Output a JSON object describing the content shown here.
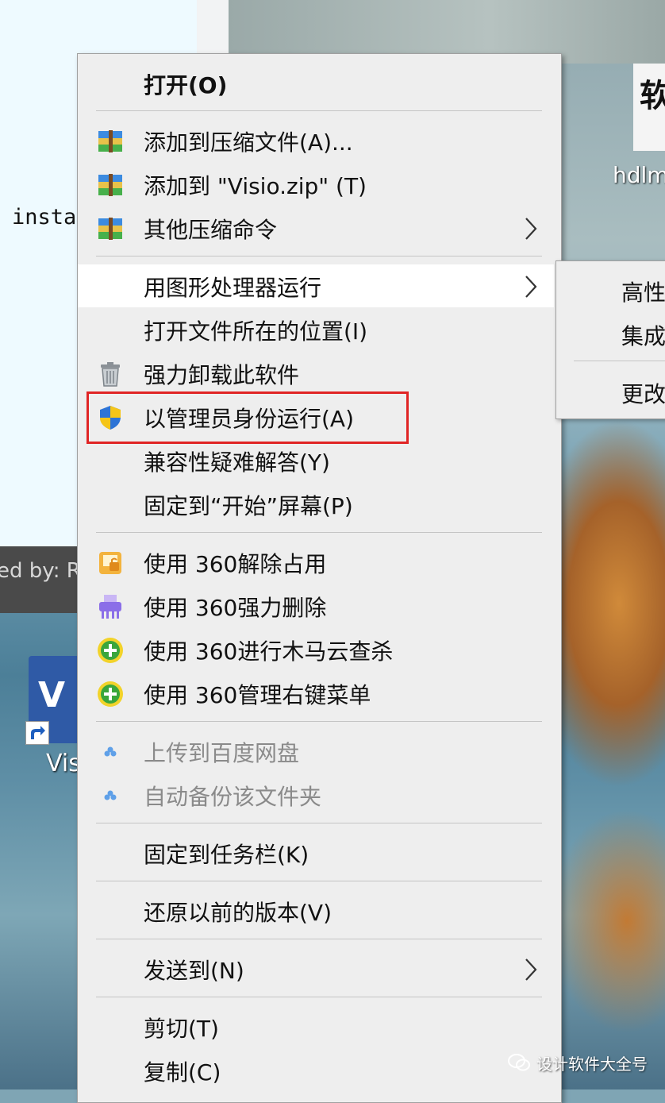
{
  "desktop": {
    "console_text": "insta",
    "status_text": "ed by: R",
    "visio_label": "Vis",
    "visio_letter": "V",
    "app_label": "hdlm",
    "app_glyph": "软"
  },
  "context_menu": {
    "open": "打开(O)",
    "add_to_archive": "添加到压缩文件(A)...",
    "add_to_zip": "添加到 \"Visio.zip\" (T)",
    "other_compress": "其他压缩命令",
    "run_with_gpu": "用图形处理器运行",
    "open_file_location": "打开文件所在的位置(I)",
    "force_uninstall": "强力卸载此软件",
    "run_as_admin": "以管理员身份运行(A)",
    "troubleshoot_compat": "兼容性疑难解答(Y)",
    "pin_to_start": "固定到“开始”屏幕(P)",
    "unlock_360": "使用 360解除占用",
    "force_delete_360": "使用 360强力删除",
    "trojan_scan_360": "使用 360进行木马云查杀",
    "manage_menu_360": "使用 360管理右键菜单",
    "upload_baidu": "上传到百度网盘",
    "auto_backup": "自动备份该文件夹",
    "pin_to_taskbar": "固定到任务栏(K)",
    "restore_versions": "还原以前的版本(V)",
    "send_to": "发送到(N)",
    "cut": "剪切(T)",
    "copy": "复制(C)"
  },
  "submenu": {
    "item1": "高性",
    "item2": "集成",
    "item3": "更改"
  },
  "watermark": {
    "text": "设计软件大全号"
  },
  "colors": {
    "menu_bg": "#eeeeee",
    "hover_bg": "#ffffff",
    "highlight_border": "#e02424",
    "disabled_text": "#8a8a8a"
  }
}
